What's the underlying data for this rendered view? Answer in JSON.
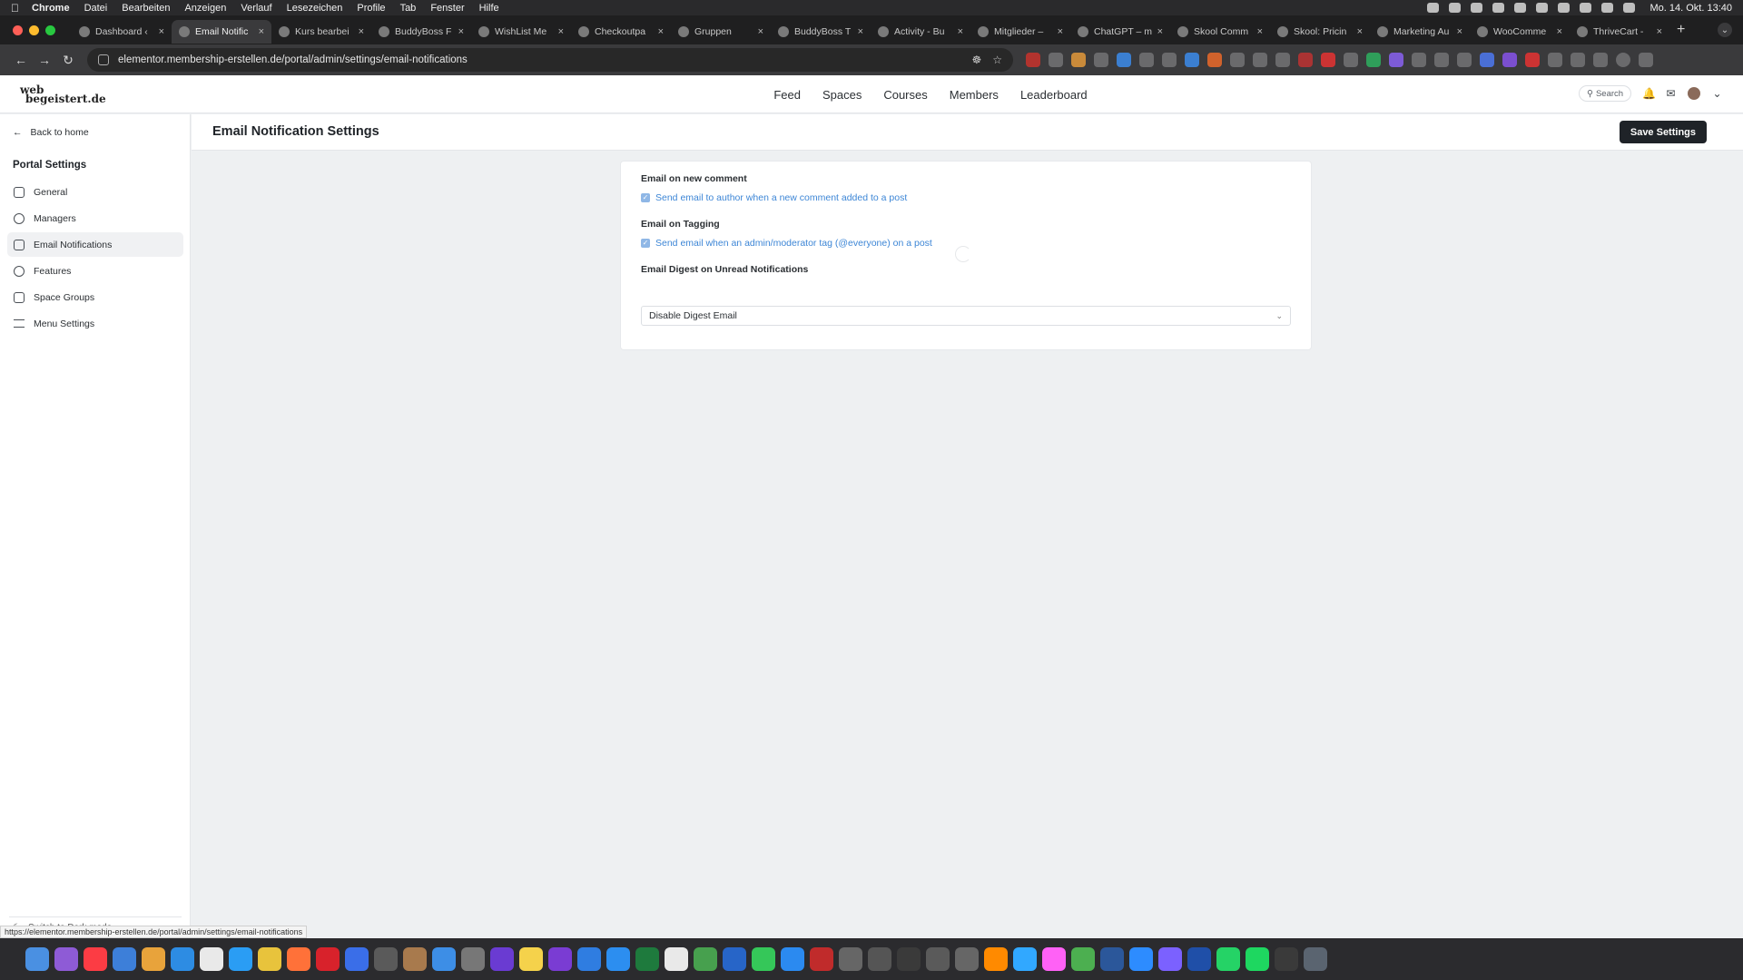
{
  "menubar": {
    "app": "Chrome",
    "items": [
      "Datei",
      "Bearbeiten",
      "Anzeigen",
      "Verlauf",
      "Lesezeichen",
      "Profile",
      "Tab",
      "Fenster",
      "Hilfe"
    ],
    "clock": "Mo. 14. Okt. 13:40"
  },
  "tabs": [
    {
      "title": "Dashboard ‹",
      "active": false
    },
    {
      "title": "Email Notific",
      "active": true
    },
    {
      "title": "Kurs bearbei",
      "active": false
    },
    {
      "title": "BuddyBoss F",
      "active": false
    },
    {
      "title": "WishList Me",
      "active": false
    },
    {
      "title": "Checkoutpa",
      "active": false
    },
    {
      "title": "Gruppen",
      "active": false
    },
    {
      "title": "BuddyBoss T",
      "active": false
    },
    {
      "title": "Activity - Bu",
      "active": false
    },
    {
      "title": "Mitglieder – ",
      "active": false
    },
    {
      "title": "ChatGPT – m",
      "active": false
    },
    {
      "title": "Skool Comm",
      "active": false
    },
    {
      "title": "Skool: Pricin",
      "active": false
    },
    {
      "title": "Marketing Au",
      "active": false
    },
    {
      "title": "WooComme",
      "active": false
    },
    {
      "title": "ThriveCart -",
      "active": false
    }
  ],
  "browser": {
    "url": "elementor.membership-erstellen.de/portal/admin/settings/email-notifications"
  },
  "site": {
    "logo_line1": "web",
    "logo_line2": "begeistert.de",
    "nav": [
      "Feed",
      "Spaces",
      "Courses",
      "Members",
      "Leaderboard"
    ],
    "search_label": "Search"
  },
  "sidebar": {
    "back_label": "Back to home",
    "heading": "Portal Settings",
    "items": [
      {
        "label": "General",
        "active": false
      },
      {
        "label": "Managers",
        "active": false
      },
      {
        "label": "Email Notifications",
        "active": true
      },
      {
        "label": "Features",
        "active": false
      },
      {
        "label": "Space Groups",
        "active": false
      },
      {
        "label": "Menu Settings",
        "active": false
      }
    ],
    "dark_mode_label": "Switch to Dark mode"
  },
  "content": {
    "title": "Email Notification Settings",
    "save_label": "Save Settings"
  },
  "settings": {
    "comment_heading": "Email on new comment",
    "comment_option": "Send email to author when a new comment added to a post",
    "comment_checked": true,
    "tagging_heading": "Email on Tagging",
    "tagging_option": "Send email when an admin/moderator tag (@everyone) on a post",
    "tagging_checked": true,
    "digest_heading": "Email Digest on Unread Notifications",
    "digest_value": "Disable Digest Email"
  },
  "status_url": "https://elementor.membership-erstellen.de/portal/admin/settings/email-notifications",
  "colors": {
    "accent": "#3d86d6",
    "primary_button": "#1f2328"
  }
}
